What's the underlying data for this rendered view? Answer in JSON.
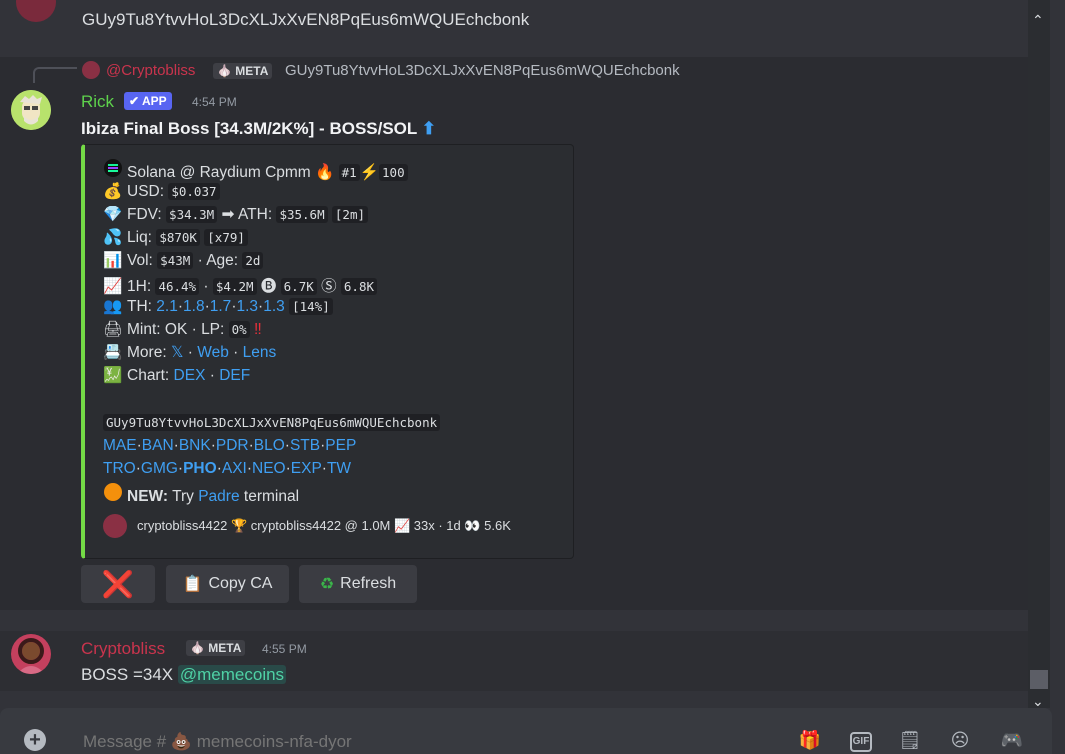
{
  "top_message": {
    "text": "GUy9Tu8YtvvHoL3DcXLJxXvEN8PqEus6mWQUEchcbonk"
  },
  "rick_message": {
    "reply": {
      "user": "@Cryptobliss",
      "tag": "META",
      "text": "GUy9Tu8YtvvHoL3DcXLJxXvEN8PqEus6mWQUEchcbonk"
    },
    "author": "Rick",
    "app_tag": "APP",
    "time": "4:54 PM",
    "title": "Ibiza Final Boss [34.3M/2K%] - BOSS/SOL",
    "title_arrow": "⬆",
    "embed": {
      "accent_color": "#74da46",
      "line1": {
        "text": "Solana @ Raydium Cpmm",
        "rank": "#1",
        "score": "100"
      },
      "usd": {
        "label": "USD:",
        "value": "$0.037"
      },
      "fdv": {
        "label": "FDV:",
        "value": "$34.3M",
        "arrow": "➡",
        "ath_label": "ATH:",
        "ath_value": "$35.6M",
        "ath_age": "[2m]"
      },
      "liq": {
        "label": "Liq:",
        "value": "$870K",
        "multiplier": "[x79]"
      },
      "vol": {
        "label": "Vol:",
        "value": "$43M",
        "age_label": "· Age:",
        "age_value": "2d"
      },
      "h1": {
        "label": "1H:",
        "pct": "46.4%",
        "sep": "·",
        "vol": "$4.2M",
        "buys": "6.7K",
        "sells": "6.8K"
      },
      "th": {
        "label": "TH:",
        "values": [
          "2.1",
          "1.8",
          "1.7",
          "1.3",
          "1.3"
        ],
        "total": "[14%]"
      },
      "mint": {
        "text": "Mint: OK · LP:",
        "value": "0%",
        "warn": "‼"
      },
      "more": {
        "label": "More:",
        "links": [
          "𝕏",
          "Web",
          "Lens"
        ]
      },
      "chart": {
        "label": "Chart:",
        "links": [
          "DEX",
          "DEF"
        ]
      },
      "ca": "GUy9Tu8YtvvHoL3DcXLJxXvEN8PqEus6mWQUEchcbonk",
      "bots_row1": [
        "MAE",
        "BAN",
        "BNK",
        "PDR",
        "BLO",
        "STB",
        "PEP"
      ],
      "bots_row2": [
        "TRO",
        "GMG",
        "PHO",
        "AXI",
        "NEO",
        "EXP",
        "TW"
      ],
      "news": {
        "label": "NEW:",
        "pre": "Try",
        "link": "Padre",
        "post": "terminal"
      },
      "footer": "cryptobliss4422 🏆 cryptobliss4422 @ 1.0M 📈 33x · 1d 👀 5.6K"
    },
    "buttons": {
      "close": "❌",
      "copy_icon": "📋",
      "copy": "Copy CA",
      "refresh_icon": "♻",
      "refresh": "Refresh"
    }
  },
  "crypto_message": {
    "author": "Cryptobliss",
    "tag": "META",
    "time": "4:55 PM",
    "text": "BOSS =34X",
    "mention": "@memecoins"
  },
  "composer": {
    "placeholder": "Message # 💩 memecoins-nfa-dyor"
  },
  "icons": [
    "add-icon",
    "gift-icon",
    "gif-icon",
    "sticker-icon",
    "emoji-icon",
    "game-icon"
  ]
}
